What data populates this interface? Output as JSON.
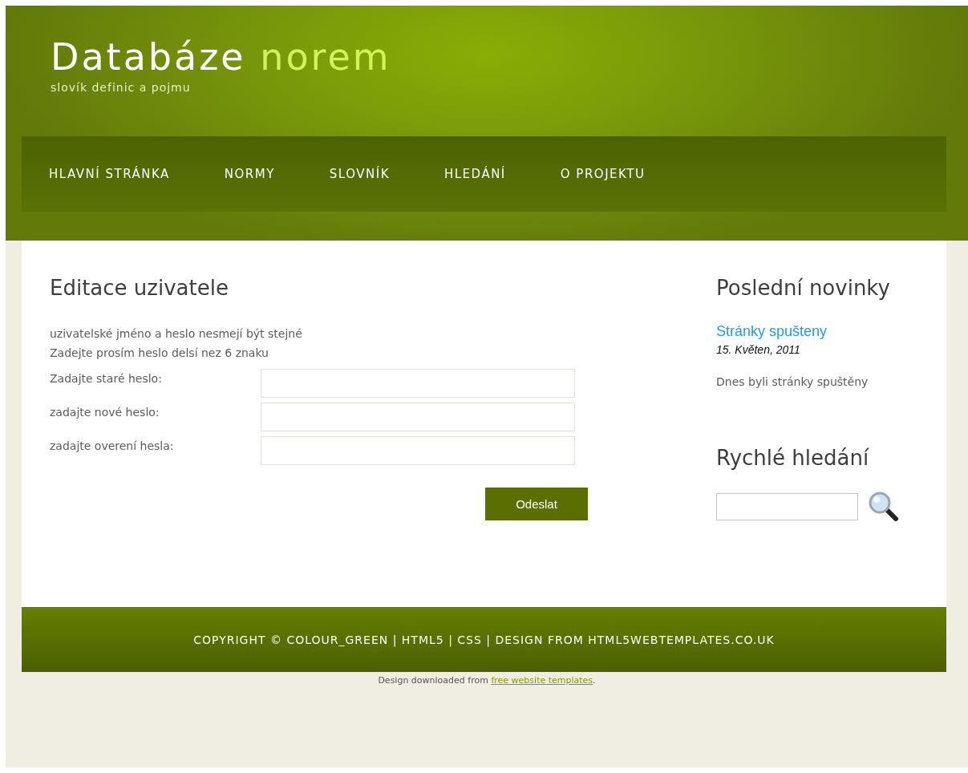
{
  "header": {
    "title": "Databáze",
    "title_accent": "norem",
    "subtitle": "slovík definic a pojmu"
  },
  "nav": [
    {
      "label": "HLAVNÍ STRÁNKA"
    },
    {
      "label": "NORMY"
    },
    {
      "label": "SLOVNÍK"
    },
    {
      "label": "HLEDÁNÍ"
    },
    {
      "label": "O PROJEKTU"
    }
  ],
  "main": {
    "heading": "Editace uzivatele",
    "notes": [
      "uzivatelské jméno a heslo nesmejí být stejné",
      "Zadejte prosím heslo delsí nez 6 znaku"
    ],
    "fields": [
      {
        "label": "Zadajte staré heslo:"
      },
      {
        "label": "zadajte nové heslo:"
      },
      {
        "label": "zadajte overení hesla:"
      }
    ],
    "submit": "Odeslat"
  },
  "sidebar": {
    "news_heading": "Poslední novinky",
    "news": [
      {
        "title": "Stránky spušteny",
        "date": "15. Květen, 2011",
        "text": "Dnes byli stránky spuštěny"
      }
    ],
    "search_heading": "Rychlé hledání"
  },
  "footer": {
    "text": "COPYRIGHT © COLOUR_GREEN | HTML5 | CSS | DESIGN FROM HTML5WEBTEMPLATES.CO.UK"
  },
  "credit": {
    "before": "Design downloaded from ",
    "link": "free website templates",
    "after": "."
  }
}
